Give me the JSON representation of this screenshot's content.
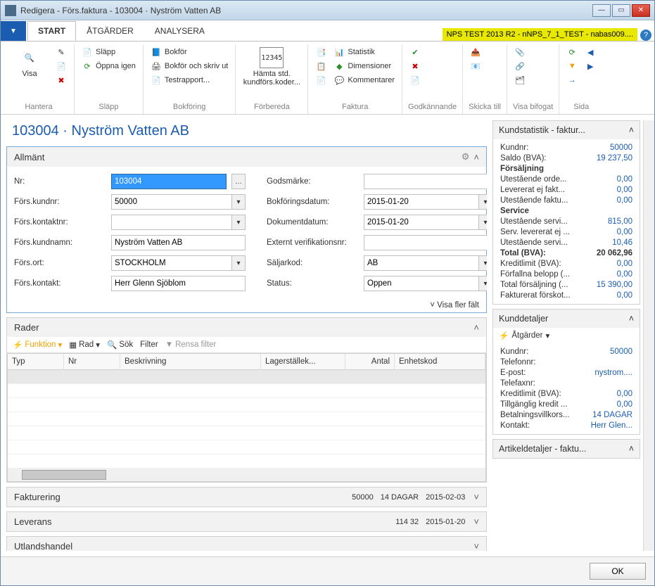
{
  "title": "Redigera - Förs.faktura - 103004 · Nyström Vatten AB",
  "env_badge": "NPS TEST 2013 R2 - nNPS_7_1_TEST - nabas009....",
  "tabs": {
    "start": "START",
    "actions": "ÅTGÄRDER",
    "analyze": "ANALYSERA"
  },
  "ribbon": {
    "hantera": {
      "caption": "Hantera",
      "visa": "Visa"
    },
    "slapp": {
      "caption": "Släpp",
      "slapp": "Släpp",
      "oppna": "Öppna igen"
    },
    "bokforing": {
      "caption": "Bokföring",
      "bokfor": "Bokför",
      "bokforskriv": "Bokför och skriv ut",
      "test": "Testrapport..."
    },
    "forbereda": {
      "caption": "Förbereda",
      "hamtastd": "Hämta std. kundförs.koder..."
    },
    "faktura": {
      "caption": "Faktura",
      "statistik": "Statistik",
      "dimensioner": "Dimensioner",
      "kommentarer": "Kommentarer"
    },
    "godkannande": "Godkännande",
    "skicka": "Skicka till",
    "visabifogat": "Visa bifogat",
    "sida": "Sida"
  },
  "page_heading": "103004 · Nyström Vatten AB",
  "general": {
    "title": "Allmänt",
    "rows": {
      "nr_l": "Nr:",
      "nr_v": "103004",
      "kundnr_l": "Förs.kundnr:",
      "kundnr_v": "50000",
      "kontaktnr_l": "Förs.kontaktnr:",
      "kontaktnr_v": "",
      "kundnamn_l": "Förs.kundnamn:",
      "kundnamn_v": "Nyström Vatten AB",
      "ort_l": "Förs.ort:",
      "ort_v": "STOCKHOLM",
      "kontakt_l": "Förs.kontakt:",
      "kontakt_v": "Herr Glenn Sjöblom",
      "gods_l": "Godsmärke:",
      "gods_v": "",
      "bokdat_l": "Bokföringsdatum:",
      "bokdat_v": "2015-01-20",
      "dokdat_l": "Dokumentdatum:",
      "dokdat_v": "2015-01-20",
      "extver_l": "Externt verifikationsnr:",
      "extver_v": "",
      "saljar_l": "Säljarkod:",
      "saljar_v": "AB",
      "status_l": "Status:",
      "status_v": "Öppen"
    },
    "showmore": "Visa fler fält"
  },
  "lines": {
    "title": "Rader",
    "funktion": "Funktion",
    "rad": "Rad",
    "sok": "Sök",
    "filter": "Filter",
    "rensa": "Rensa filter",
    "cols": {
      "typ": "Typ",
      "nr": "Nr",
      "beskr": "Beskrivning",
      "lager": "Lagerställek...",
      "antal": "Antal",
      "enhet": "Enhetskod"
    }
  },
  "fakturering": {
    "title": "Fakturering",
    "s1": "50000",
    "s2": "14 DAGAR",
    "s3": "2015-02-03"
  },
  "leverans": {
    "title": "Leverans",
    "s1": "114 32",
    "s2": "2015-01-20"
  },
  "utland": {
    "title": "Utlandshandel"
  },
  "kundstat": {
    "title": "Kundstatistik - faktur...",
    "rows": [
      {
        "k": "Kundnr:",
        "v": "50000"
      },
      {
        "k": "Saldo (BVA):",
        "v": "19 237,50"
      },
      {
        "k": "Försäljning",
        "section": true
      },
      {
        "k": "Utestående orde...",
        "v": "0,00"
      },
      {
        "k": "Levererat ej fakt...",
        "v": "0,00"
      },
      {
        "k": "Utestående faktu...",
        "v": "0,00"
      },
      {
        "k": "Service",
        "section": true
      },
      {
        "k": "Utestående servi...",
        "v": "815,00"
      },
      {
        "k": "Serv. levererat ej ...",
        "v": "0,00"
      },
      {
        "k": "Utestående servi...",
        "v": "10,46"
      },
      {
        "k": "Total (BVA):",
        "v": "20 062,96",
        "bold": true
      },
      {
        "k": "Kreditlimit (BVA):",
        "v": "0,00"
      },
      {
        "k": "Förfallna belopp (...",
        "v": "0,00"
      },
      {
        "k": "Total försäljning (...",
        "v": "15 390,00"
      },
      {
        "k": "Fakturerat förskot...",
        "v": "0,00"
      }
    ]
  },
  "kunddet": {
    "title": "Kunddetaljer",
    "action": "Åtgärder",
    "rows": [
      {
        "k": "Kundnr:",
        "v": "50000"
      },
      {
        "k": "Telefonnr:",
        "v": ""
      },
      {
        "k": "E-post:",
        "v": "nystrom...."
      },
      {
        "k": "Telefaxnr:",
        "v": ""
      },
      {
        "k": "Kreditlimit (BVA):",
        "v": "0,00"
      },
      {
        "k": "Tillgänglig kredit ...",
        "v": "0,00"
      },
      {
        "k": "Betalningsvillkors...",
        "v": "14 DAGAR"
      },
      {
        "k": "Kontakt:",
        "v": "Herr Glen..."
      }
    ]
  },
  "artdet": {
    "title": "Artikeldetaljer - faktu..."
  },
  "ok": "OK"
}
